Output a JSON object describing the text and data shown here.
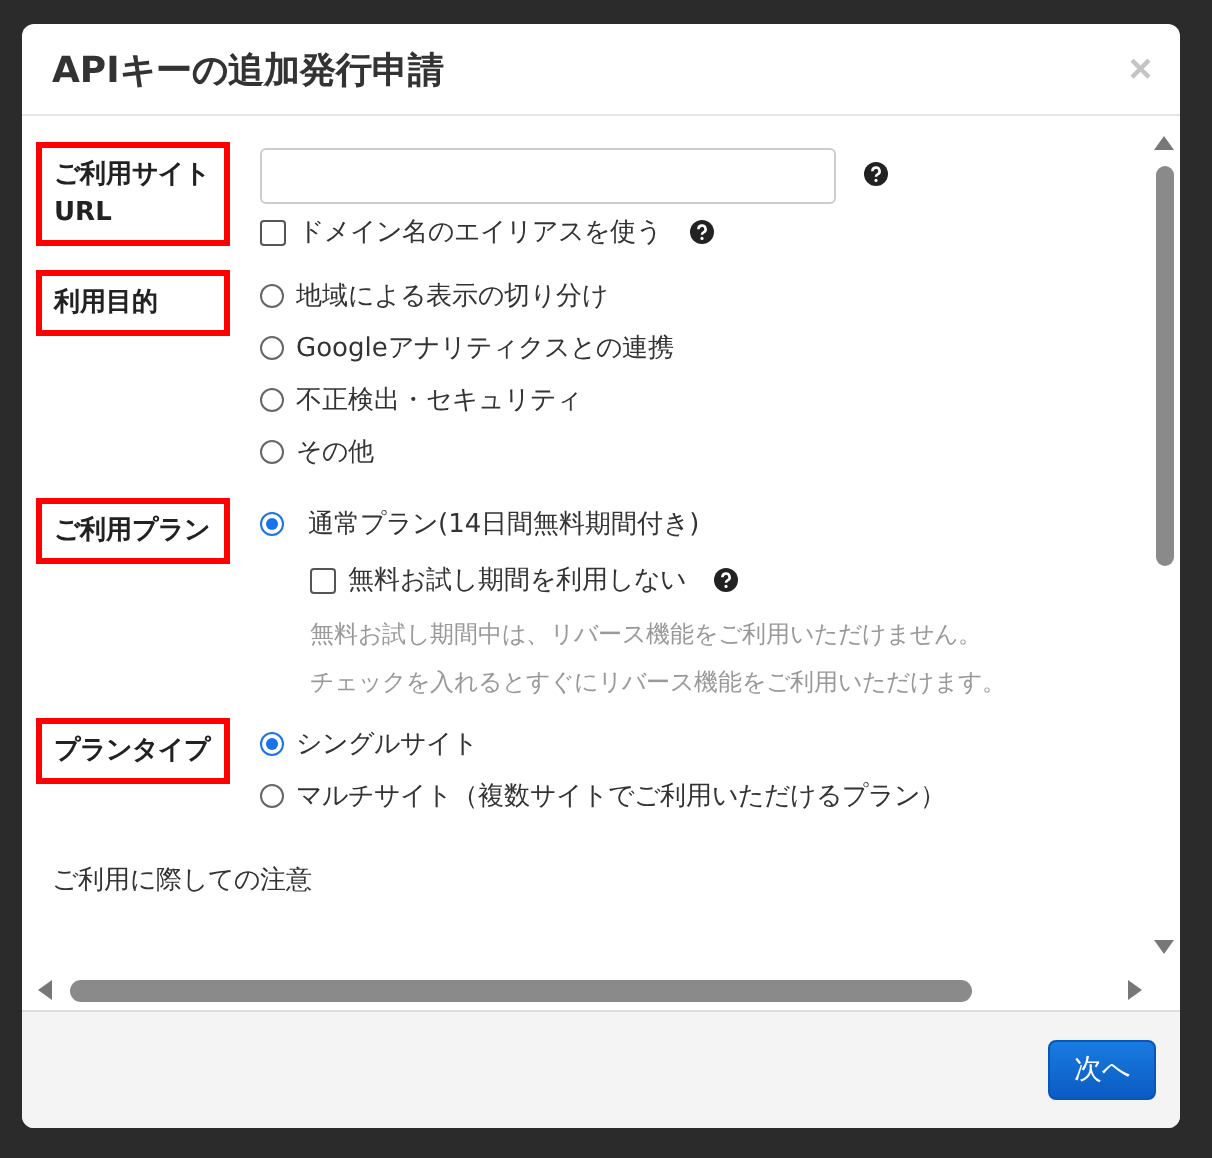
{
  "dialog": {
    "title": "APIキーの追加発行申請",
    "close": "×",
    "fields": [
      {
        "kind": "url",
        "label": "ご利用サイトURL",
        "help": true,
        "checkbox": {
          "label": "ドメイン名のエイリアスを使う",
          "checked": false,
          "help": true
        }
      },
      {
        "kind": "radios",
        "label": "利用目的",
        "options": [
          {
            "label": "地域による表示の切り分け",
            "selected": false
          },
          {
            "label": "Googleアナリティクスとの連携",
            "selected": false
          },
          {
            "label": "不正検出・セキュリティ",
            "selected": false
          },
          {
            "label": "その他",
            "selected": false
          }
        ]
      },
      {
        "kind": "plan",
        "label": "ご利用プラン",
        "option": {
          "label": "通常プラン(14日間無料期間付き)",
          "selected": true
        },
        "checkbox": {
          "label": "無料お試し期間を利用しない",
          "checked": false,
          "help": true
        },
        "notes": [
          "無料お試し期間中は、リバース機能をご利用いただけません。",
          "チェックを入れるとすぐにリバース機能をご利用いただけます。"
        ]
      },
      {
        "kind": "radios",
        "label": "プランタイプ",
        "options": [
          {
            "label": "シングルサイト",
            "selected": true
          },
          {
            "label": "マルチサイト（複数サイトでご利用いただけるプラン）",
            "selected": false
          }
        ]
      }
    ],
    "notice": "ご利用に際しての注意",
    "next_button": "次へ"
  }
}
